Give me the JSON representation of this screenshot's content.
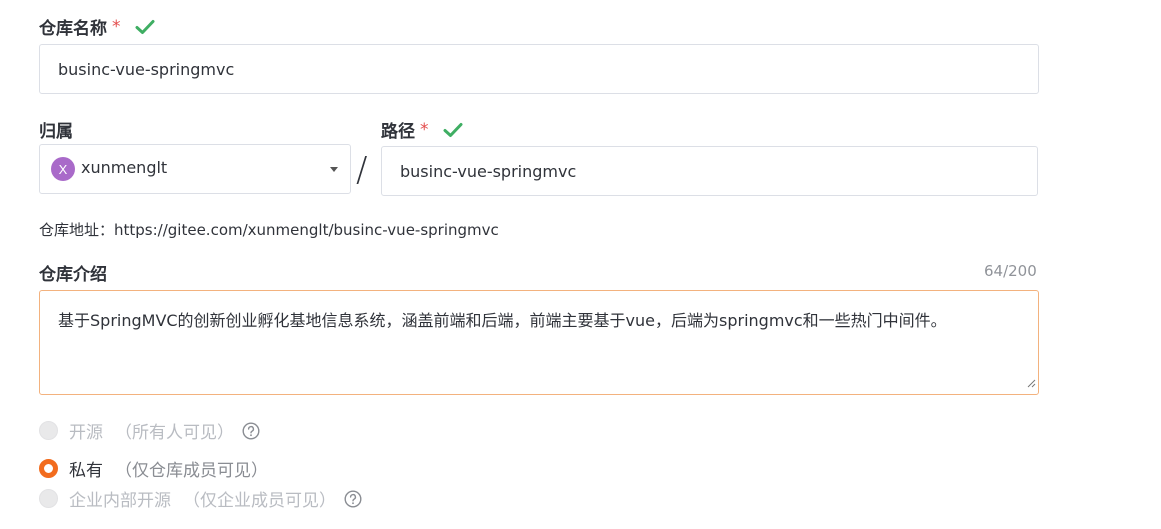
{
  "form": {
    "repo_name": {
      "label": "仓库名称",
      "required_mark": "*",
      "value": "businc-vue-springmvc"
    },
    "owner": {
      "label": "归属",
      "avatar_letter": "X",
      "value": "xunmenglt"
    },
    "separator": "/",
    "path": {
      "label": "路径",
      "required_mark": "*",
      "value": "businc-vue-springmvc"
    },
    "repo_url": {
      "label": "仓库地址：",
      "value": "https://gitee.com/xunmenglt/businc-vue-springmvc"
    },
    "description": {
      "label": "仓库介绍",
      "counter": "64/200",
      "value": "基于SpringMVC的创新创业孵化基地信息系统，涵盖前端和后端，前端主要基于vue，后端为springmvc和一些热门中间件。"
    },
    "visibility": [
      {
        "label": "开源",
        "note": "（所有人可见）",
        "state": "disabled",
        "has_help": true
      },
      {
        "label": "私有",
        "note": "（仅仓库成员可见）",
        "state": "checked",
        "has_help": false
      },
      {
        "label": "企业内部开源",
        "note": "（仅企业成员可见）",
        "state": "disabled",
        "has_help": true
      }
    ]
  },
  "colors": {
    "accent": "#f26c1e",
    "valid_check": "#3fae63",
    "required": "#e34d4d",
    "avatar_bg": "#a96ac9"
  },
  "icons": [
    "check-icon",
    "chevron-down-icon",
    "help-circle-icon",
    "resize-grip-icon"
  ]
}
